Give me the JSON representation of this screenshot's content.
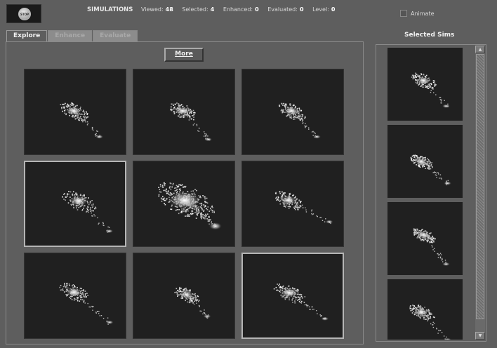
{
  "toolbar": {
    "stop_label": "STOP",
    "title": "SIMULATIONS",
    "stats": [
      {
        "label": "Viewed:",
        "value": "48"
      },
      {
        "label": "Selected:",
        "value": "4"
      },
      {
        "label": "Enhanced:",
        "value": "0"
      },
      {
        "label": "Evaluated:",
        "value": "0"
      },
      {
        "label": "Level:",
        "value": "0"
      }
    ],
    "animate_label": "Animate",
    "animate_checked": false
  },
  "tabs": [
    {
      "label": "Explore",
      "active": true
    },
    {
      "label": "Enhance",
      "active": false
    },
    {
      "label": "Evaluate",
      "active": false
    }
  ],
  "explore": {
    "more_label": "More",
    "grid": [
      {
        "selected": false,
        "image": "galaxy-simulation"
      },
      {
        "selected": false,
        "image": "galaxy-simulation"
      },
      {
        "selected": false,
        "image": "galaxy-simulation"
      },
      {
        "selected": true,
        "image": "galaxy-simulation"
      },
      {
        "selected": false,
        "image": "galaxy-simulation"
      },
      {
        "selected": false,
        "image": "galaxy-simulation"
      },
      {
        "selected": false,
        "image": "galaxy-simulation"
      },
      {
        "selected": false,
        "image": "galaxy-simulation"
      },
      {
        "selected": true,
        "image": "galaxy-simulation"
      }
    ]
  },
  "selected_sims": {
    "title": "Selected Sims",
    "count": 4,
    "scroll_up": "up-arrow-icon",
    "scroll_down": "down-arrow-icon"
  }
}
